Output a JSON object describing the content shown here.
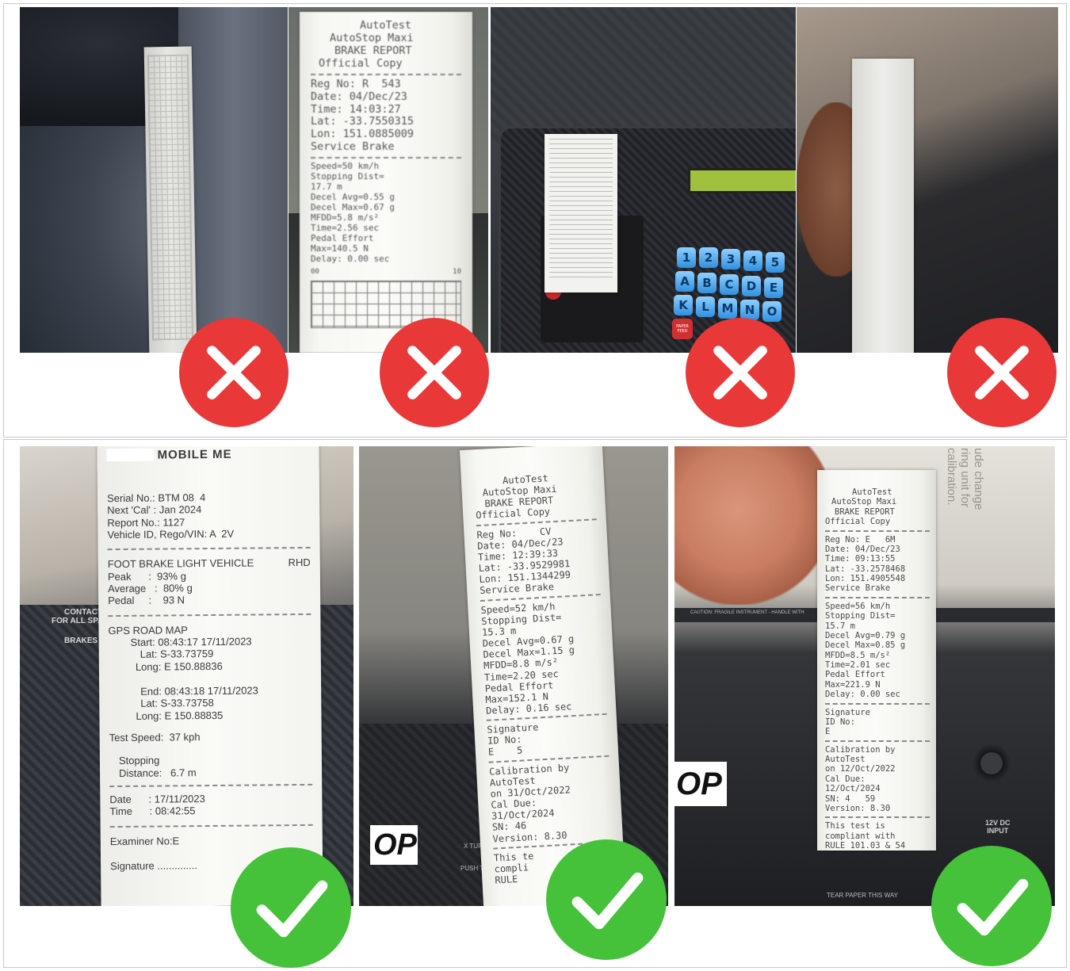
{
  "colors": {
    "reject": "#e83838",
    "accept": "#45c13a",
    "mark_stroke": "#ffffff",
    "frame_border": "#c8c8c8"
  },
  "icons": {
    "reject": "cross-icon",
    "accept": "checkmark-icon"
  },
  "top_row": {
    "receipt_a": {
      "lines": [
        "AutoTest",
        "AutoStop Maxi",
        "BRAKE REPORT",
        "Official Copy",
        "Reg No: R  543",
        "Date: 04/Dec/23",
        "Time: 14:03:27",
        "Lat: -33.7550315",
        "Lon: 151.0885009",
        "Service Brake",
        "Speed=50 km/h",
        "Stopping Dist=",
        "17.7 m",
        "Decel Avg=0.55 g",
        "Decel Max=0.67 g",
        "MFDD=5.8 m/s²",
        "Time=2.56 sec",
        "Pedal Effort",
        "Max=140.5 N",
        "Delay: 0.00 sec"
      ],
      "scale_left": "00",
      "scale_right": "10"
    },
    "device": {
      "keys": [
        "1",
        "2",
        "3",
        "4",
        "5",
        "A",
        "B",
        "C",
        "D",
        "E",
        "K",
        "L",
        "M",
        "N",
        "O"
      ],
      "paper_feed": "PAPER FEED"
    }
  },
  "bottom_row": {
    "receipt_1": {
      "header": "MOBILE ME",
      "serial": "Serial No.: BTM 08  4",
      "next_cal": "Next 'Cal' : Jan 2024",
      "report_no": "Report No.: 1127",
      "vehicle_id": "Vehicle ID, Rego/VIN: A  2V",
      "section": "FOOT BRAKE LIGHT VEHICLE",
      "rhd": "RHD",
      "peak": "Peak      :  93% g",
      "average": "Average   :  80% g",
      "pedal": "Pedal     :    93 N",
      "gps": "GPS ROAD MAP",
      "start": "Start: 08:43:17 17/11/2023",
      "start_lat": "Lat: S-33.73759",
      "start_long": "Long: E 150.88836",
      "end": "End: 08:43:18 17/11/2023",
      "end_lat": "Lat: S-33.73758",
      "end_long": "Long: E 150.88835",
      "test_speed": "Test Speed:  37 kph",
      "stopping": "Stopping",
      "distance": "Distance:   6.7 m",
      "date": "Date      : 17/11/2023",
      "time": "Time      : 08:42:55",
      "examiner": "Examiner No:E",
      "signature": "Signature ..............",
      "bg_contact": "CONTACT",
      "bg_for_all": "FOR ALL SPA",
      "bg_brakes": "BRAKES"
    },
    "receipt_2": {
      "lines": [
        "AutoTest",
        "AutoStop Maxi",
        "BRAKE REPORT",
        "Official Copy",
        "Reg No:    CV",
        "Date: 04/Dec/23",
        "Time: 12:39:33",
        "Lat: -33.9529981",
        "Lon: 151.1344299",
        "Service Brake",
        "Speed=52 km/h",
        "Stopping Dist=",
        "15.3 m",
        "Decel Avg=0.67 g",
        "Decel Max=1.15 g",
        "MFDD=8.8 m/s²",
        "Time=2.20 sec",
        "Pedal Effort",
        "Max=152.1 N",
        "Delay: 0.16 sec",
        "Signature",
        "ID No:",
        "E    5",
        "Calibration by",
        "AutoTest",
        "on 31/Oct/2022",
        "Cal Due:",
        "31/Oct/2024",
        "SN: 46",
        "Version: 8.30",
        "This te",
        "compli",
        "RULE"
      ],
      "bg_label": "OP",
      "bg_turn": "X TURN",
      "bg_push": "PUSH TO"
    },
    "receipt_3": {
      "lines": [
        "AutoTest",
        "AutoStop Maxi",
        "BRAKE REPORT",
        "Official Copy",
        "Reg No: E   6M",
        "Date: 04/Dec/23",
        "Time: 09:13:55",
        "Lat: -33.2578468",
        "Lon: 151.4905548",
        "Service Brake",
        "Speed=56 km/h",
        "Stopping Dist=",
        "15.7 m",
        "Decel Avg=0.79 g",
        "Decel Max=0.85 g",
        "MFDD=8.5 m/s²",
        "Time=2.01 sec",
        "Pedal Effort",
        "Max=221.9 N",
        "Delay: 0.00 sec",
        "Signature",
        "ID No:",
        "E",
        "Calibration by",
        "AutoTest",
        "on 12/Oct/2022",
        "Cal Due:",
        "12/Oct/2024",
        "SN: 4   59",
        "Version: 8.30",
        "This test is",
        "compliant with",
        "RULE 101.03 & 54"
      ],
      "bg_label": "OP",
      "bg_12v": "12V DC",
      "bg_input": "INPUT",
      "bg_tear": "TEAR PAPER THIS WAY",
      "bg_caution": "CAUTION: FRAGILE INSTRUMENT - HANDLE WITH",
      "bg_side": "ude change\nring unit for\ncalibration."
    }
  }
}
